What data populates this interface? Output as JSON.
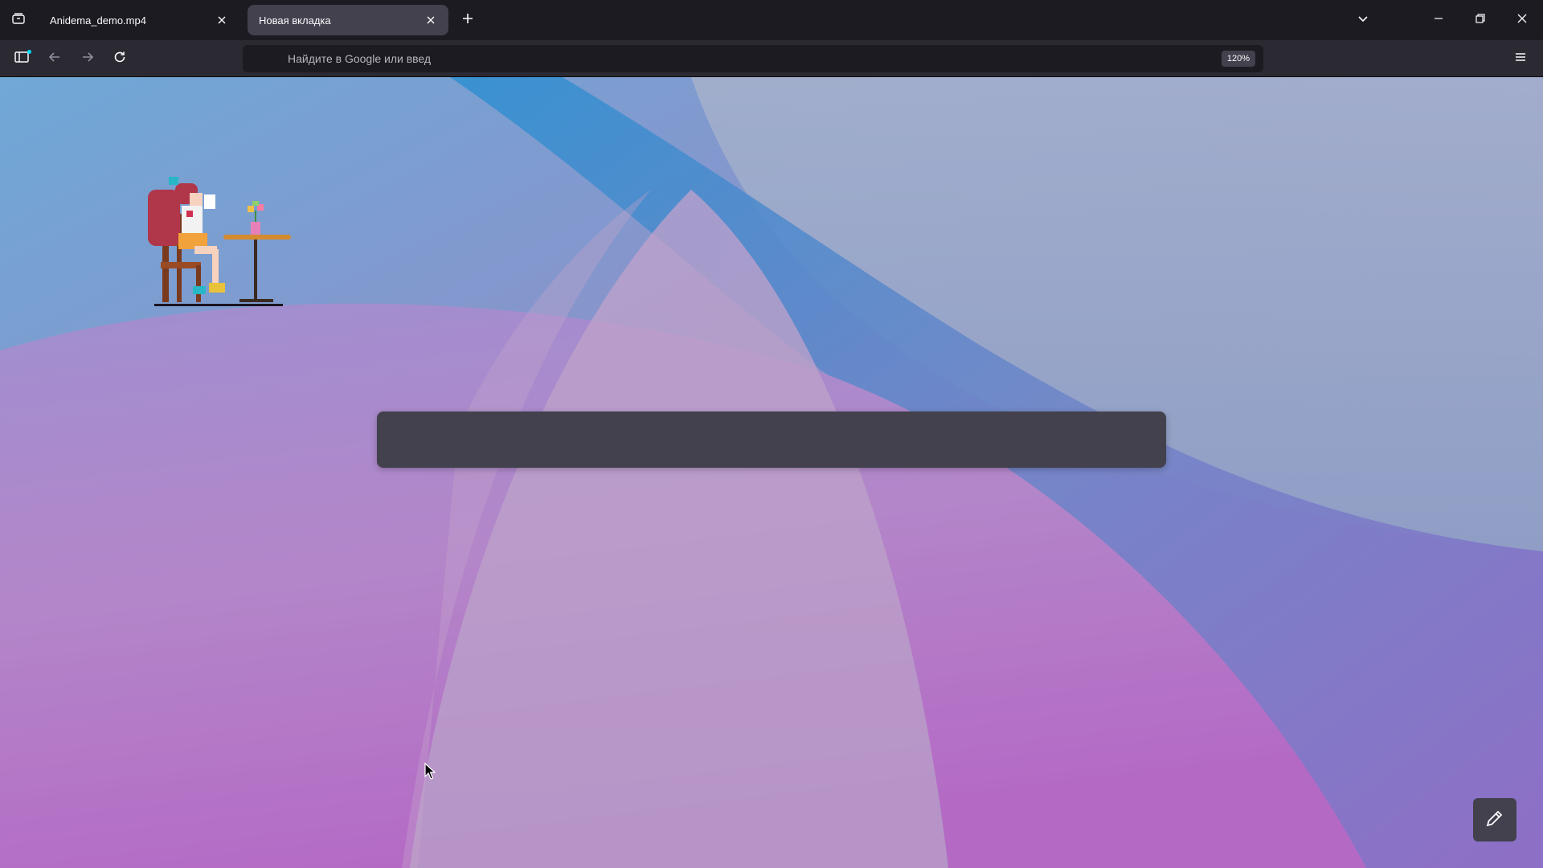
{
  "tabs": [
    {
      "title": "Anidema_demo.mp4",
      "active": false
    },
    {
      "title": "Новая вкладка",
      "active": true
    }
  ],
  "icons": {
    "tab_list": "tab-list-icon",
    "close": "close-icon",
    "new_tab": "plus-icon",
    "all_tabs": "chevron-down-icon",
    "minimize": "minimize-icon",
    "restore": "restore-icon",
    "window_close": "close-icon",
    "sidebar": "sidebar-icon",
    "back": "back-arrow-icon",
    "forward": "forward-arrow-icon",
    "reload": "reload-icon",
    "menu": "hamburger-menu-icon",
    "customize": "pencil-icon"
  },
  "urlbar": {
    "placeholder": "Найдите в Google или введ",
    "zoom": "120%"
  },
  "colors": {
    "tabstrip": "#1c1b22",
    "navbar": "#2b2a33",
    "active_tab": "#42414d",
    "search_box": "#42414d",
    "icon": "#fbfbfe"
  }
}
